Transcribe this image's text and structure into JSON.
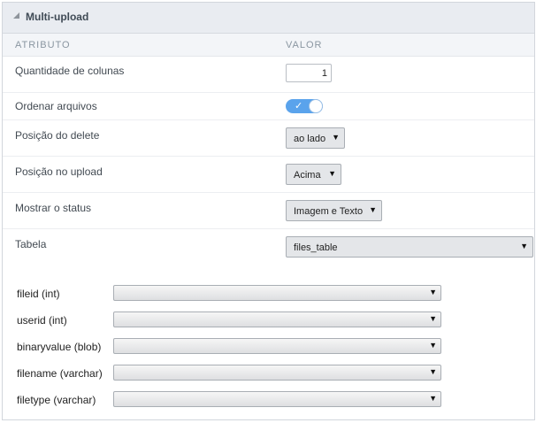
{
  "panel": {
    "title": "Multi-upload"
  },
  "table_header": {
    "attribute": "ATRIBUTO",
    "value": "VALOR"
  },
  "rows": [
    {
      "label": "Quantidade de colunas",
      "value": "1"
    },
    {
      "label": "Ordenar arquivos",
      "toggle_on": true,
      "check": "✓"
    },
    {
      "label": "Posição do delete",
      "value": "ao lado"
    },
    {
      "label": "Posição no upload",
      "value": "Acima"
    },
    {
      "label": "Mostrar o status",
      "value": "Imagem e Texto"
    },
    {
      "label": "Tabela",
      "value": "files_table"
    }
  ],
  "fields": [
    {
      "label": "fileid (int)",
      "value": ""
    },
    {
      "label": "userid (int)",
      "value": ""
    },
    {
      "label": "binaryvalue (blob)",
      "value": ""
    },
    {
      "label": "filename (varchar)",
      "value": ""
    },
    {
      "label": "filetype (varchar)",
      "value": ""
    }
  ],
  "icons": {
    "collapse": "collapse-triangle-icon",
    "dropdown": "caret-down-icon"
  },
  "colors": {
    "toggle_on": "#5aa3ec",
    "header_bg": "#e9ecf1"
  }
}
